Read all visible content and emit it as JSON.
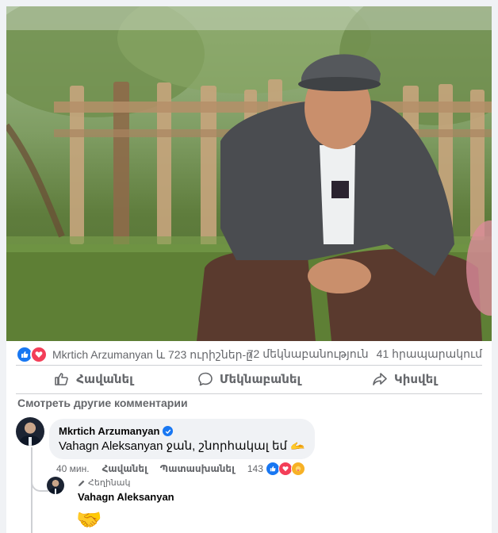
{
  "post": {
    "image_alt": "Photo of a man in a flat cap and gray blazer sitting in front of a wooden fence",
    "stats": {
      "reactions_text": "Mkrtich Arzumanyan և 723 ուրիշներ-ը",
      "comments_count": "72 մեկնաբանություն",
      "shares_count": "41 հրապարակում"
    },
    "actions": {
      "like": "Հավանել",
      "comment": "Մեկնաբանել",
      "share": "Կիսվել"
    },
    "more_comments": "Смотреть другие комментарии"
  },
  "comment": {
    "author": "Mkrtich Arzumanyan",
    "text": "Vahagn Aleksanyan ջան, շնորհակալ եմ 🫴",
    "time": "40 мин.",
    "like_label": "Հավանել",
    "reply_label": "Պատասխանել",
    "reaction_count": "143"
  },
  "reply": {
    "author_tag": "Հեղինակ",
    "author": "Vahagn Aleksanyan",
    "emoji": "🤝"
  },
  "colors": {
    "accent": "#1877f2",
    "love": "#f33e58",
    "care": "#f7b125",
    "muted_text": "#65676b",
    "bubble_bg": "#f0f2f5"
  },
  "icons": [
    "thumbs-up-icon",
    "comment-icon",
    "share-icon",
    "verified-icon",
    "pencil-icon",
    "like-reaction-icon",
    "love-reaction-icon",
    "care-reaction-icon"
  ]
}
